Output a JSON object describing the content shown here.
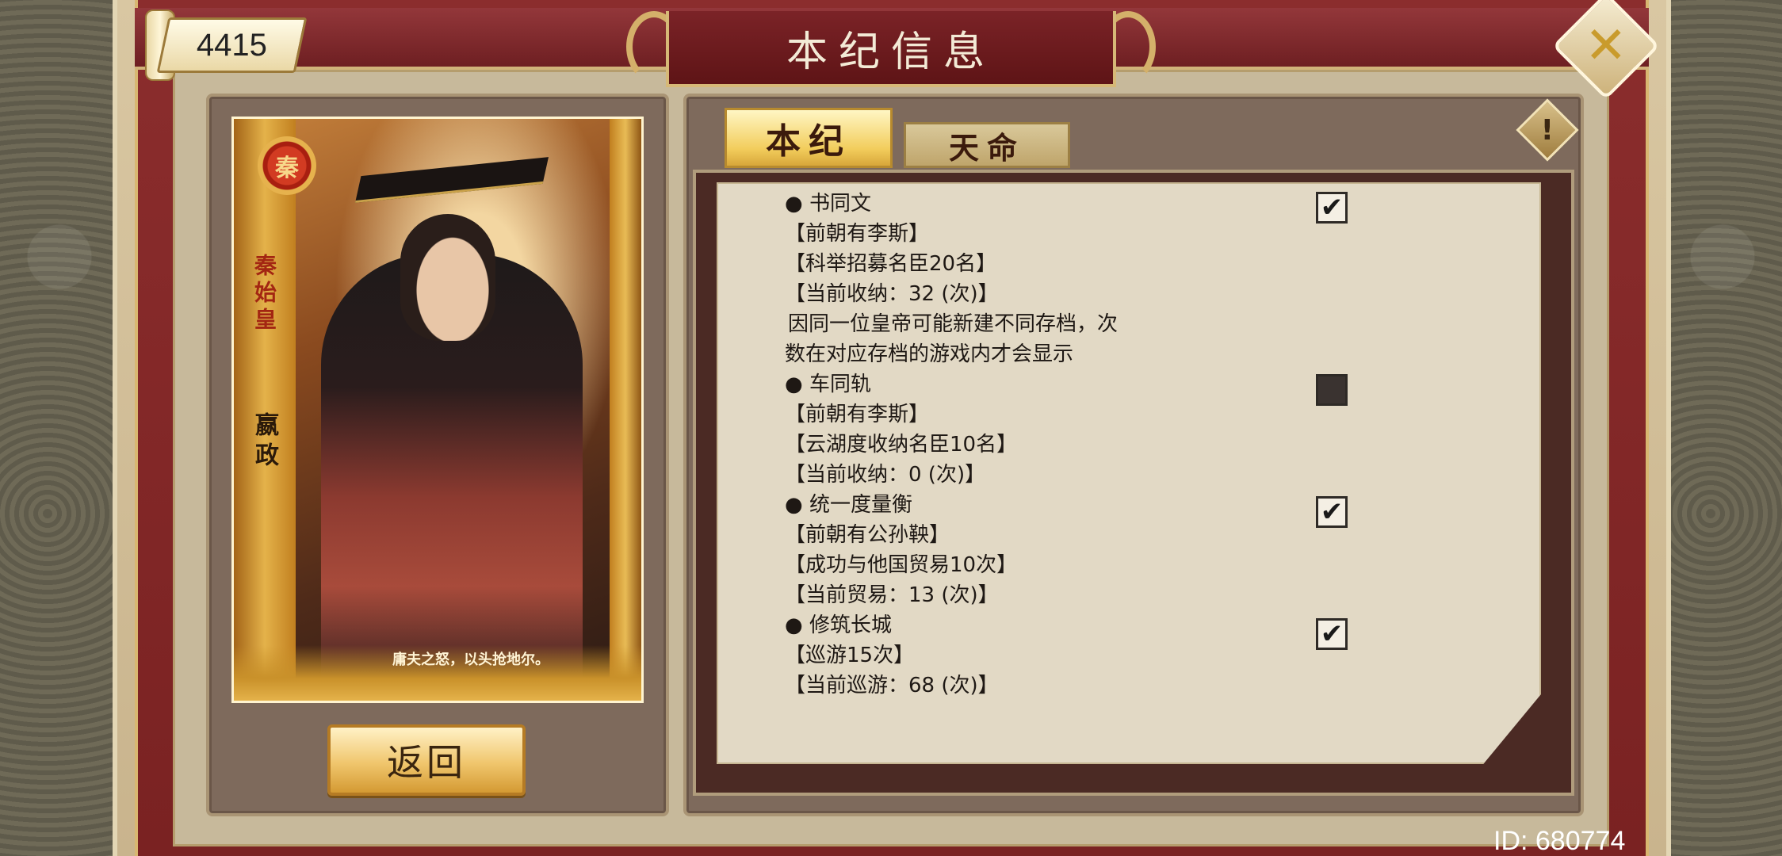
{
  "header": {
    "score": "4415",
    "title": "本纪信息"
  },
  "icons": {
    "close": "close-icon",
    "warning": "warning-icon",
    "check": "checkmark-icon"
  },
  "portrait": {
    "seal_char": "秦",
    "title_vertical": "秦始皇",
    "name_vertical": "嬴政",
    "quote": "庸夫之怒，以头抢地尔。"
  },
  "buttons": {
    "back": "返回"
  },
  "tabs": [
    {
      "label": "本纪",
      "active": true
    },
    {
      "label": "天命",
      "active": false
    }
  ],
  "entries": [
    {
      "title": "● 书同文",
      "checked": true,
      "lines": [
        "【前朝有李斯】",
        "【科举招募名臣20名】",
        "【当前收纳：32 (次)】"
      ],
      "note": [
        "因同一位皇帝可能新建不同存档，次",
        "数在对应存档的游戏内才会显示"
      ]
    },
    {
      "title": "● 车同轨",
      "checked": false,
      "lines": [
        "【前朝有李斯】",
        "【云湖度收纳名臣10名】",
        "【当前收纳：0 (次)】"
      ],
      "note": []
    },
    {
      "title": "● 统一度量衡",
      "checked": true,
      "lines": [
        "【前朝有公孙鞅】",
        "【成功与他国贸易10次】",
        "【当前贸易：13 (次)】"
      ],
      "note": []
    },
    {
      "title": "● 修筑长城",
      "checked": true,
      "lines": [
        "【巡游15次】",
        "【当前巡游：68 (次)】"
      ],
      "note": []
    }
  ],
  "footer": {
    "user_id": "ID: 680774"
  },
  "colors": {
    "frame_red": "#7a2222",
    "gold": "#d8a63a",
    "paper": "#e2d9c5"
  }
}
